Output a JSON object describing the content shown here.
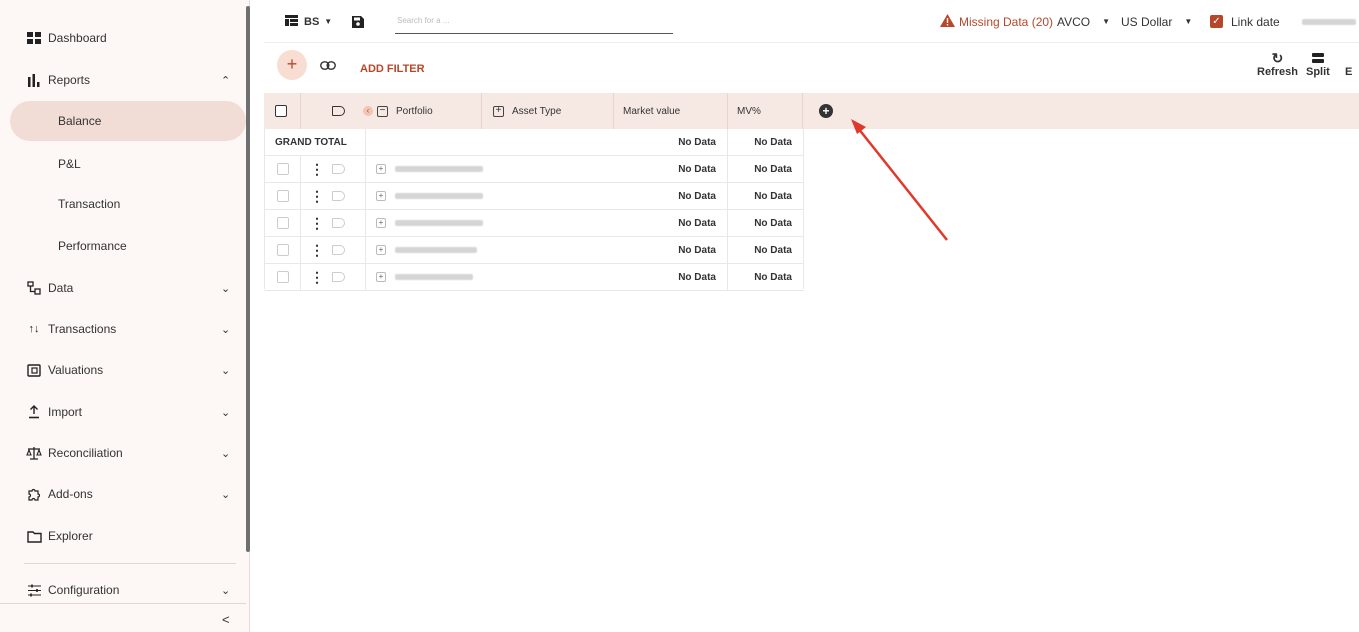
{
  "sidebar": {
    "items": [
      {
        "label": "Dashboard",
        "icon": "dashboard-icon"
      },
      {
        "label": "Reports",
        "icon": "bar-chart-icon",
        "chevron": "^"
      },
      {
        "label": "Data",
        "icon": "hierarchy-icon",
        "chevron": "v"
      },
      {
        "label": "Transactions",
        "icon": "arrows-updown-icon",
        "chevron": "v"
      },
      {
        "label": "Valuations",
        "icon": "wallet-icon",
        "chevron": "v"
      },
      {
        "label": "Import",
        "icon": "upload-icon",
        "chevron": "v"
      },
      {
        "label": "Reconciliation",
        "icon": "scales-icon",
        "chevron": "v"
      },
      {
        "label": "Add-ons",
        "icon": "puzzle-icon",
        "chevron": "v"
      },
      {
        "label": "Explorer",
        "icon": "folder-icon"
      },
      {
        "label": "Configuration",
        "icon": "sliders-icon",
        "chevron": "v"
      }
    ],
    "reports_sub": [
      "Balance",
      "P&L",
      "Transaction",
      "Performance"
    ],
    "active_sub": "Balance",
    "collapse": "<"
  },
  "topbar": {
    "view_label": "BS",
    "search_placeholder": "Search for a ...",
    "missing_data": "Missing Data (20)",
    "method": "AVCO",
    "currency": "US Dollar",
    "link_date": "Link date"
  },
  "filterbar": {
    "add_filter": "ADD FILTER",
    "refresh": "Refresh",
    "split": "Split",
    "export_partial": "E"
  },
  "grid": {
    "columns": {
      "portfolio": "Portfolio",
      "asset_type": "Asset Type",
      "market_value": "Market value",
      "mv_pct": "MV%"
    },
    "grand_total": "GRAND TOTAL",
    "grand_total_mv": "No Data",
    "grand_total_mvpct": "No Data",
    "rows": [
      {
        "market_value": "No Data",
        "mv_pct": "No Data"
      },
      {
        "market_value": "No Data",
        "mv_pct": "No Data"
      },
      {
        "market_value": "No Data",
        "mv_pct": "No Data"
      },
      {
        "market_value": "No Data",
        "mv_pct": "No Data"
      },
      {
        "market_value": "No Data",
        "mv_pct": "No Data"
      }
    ]
  },
  "colors": {
    "accent": "#b7472a",
    "sidebar_bg": "#fdf7f5",
    "active_bg": "#f1ddd6",
    "header_bg": "#f6e9e4",
    "annotation_arrow": "#e0392b"
  }
}
